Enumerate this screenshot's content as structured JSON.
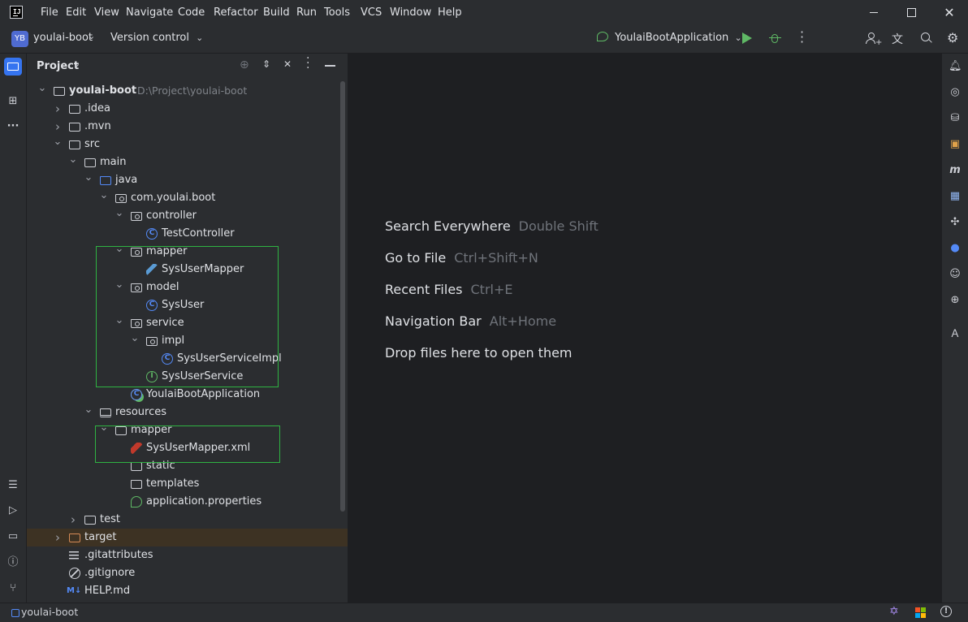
{
  "menu": [
    "File",
    "Edit",
    "View",
    "Navigate",
    "Code",
    "Refactor",
    "Build",
    "Run",
    "Tools",
    "VCS",
    "Window",
    "Help"
  ],
  "toolbar": {
    "project_badge": "YB",
    "project_name": "youlai-boot",
    "vcs_label": "Version control",
    "run_config": "YoulaiBootApplication"
  },
  "project_panel": {
    "title": "Project",
    "tree": [
      {
        "label": "youlai-boot",
        "path": "D:\\Project\\youlai-boot",
        "icon": "module-folder-icon"
      },
      {
        "label": ".idea",
        "icon": "folder-icon"
      },
      {
        "label": ".mvn",
        "icon": "folder-icon"
      },
      {
        "label": "src",
        "icon": "folder-icon"
      },
      {
        "label": "main",
        "icon": "folder-icon"
      },
      {
        "label": "java",
        "icon": "source-folder-icon"
      },
      {
        "label": "com.youlai.boot",
        "icon": "package-icon"
      },
      {
        "label": "controller",
        "icon": "package-icon"
      },
      {
        "label": "TestController",
        "icon": "class-icon"
      },
      {
        "label": "mapper",
        "icon": "package-icon"
      },
      {
        "label": "SysUserMapper",
        "icon": "mybatis-mapper-icon"
      },
      {
        "label": "model",
        "icon": "package-icon"
      },
      {
        "label": "SysUser",
        "icon": "class-icon"
      },
      {
        "label": "service",
        "icon": "package-icon"
      },
      {
        "label": "impl",
        "icon": "package-icon"
      },
      {
        "label": "SysUserServiceImpl",
        "icon": "class-icon"
      },
      {
        "label": "SysUserService",
        "icon": "interface-icon"
      },
      {
        "label": "YoulaiBootApplication",
        "icon": "spring-boot-class-icon"
      },
      {
        "label": "resources",
        "icon": "resources-folder-icon"
      },
      {
        "label": "mapper",
        "icon": "folder-icon"
      },
      {
        "label": "SysUserMapper.xml",
        "icon": "mybatis-xml-icon"
      },
      {
        "label": "static",
        "icon": "folder-icon"
      },
      {
        "label": "templates",
        "icon": "folder-icon"
      },
      {
        "label": "application.properties",
        "icon": "spring-properties-icon"
      },
      {
        "label": "test",
        "icon": "folder-icon"
      },
      {
        "label": "target",
        "icon": "excluded-folder-icon"
      },
      {
        "label": ".gitattributes",
        "icon": "text-file-icon"
      },
      {
        "label": ".gitignore",
        "icon": "gitignore-icon"
      },
      {
        "label": "HELP.md",
        "icon": "markdown-icon"
      }
    ]
  },
  "editor_hints": [
    {
      "action": "Search Everywhere",
      "shortcut": "Double Shift"
    },
    {
      "action": "Go to File",
      "shortcut": "Ctrl+Shift+N"
    },
    {
      "action": "Recent Files",
      "shortcut": "Ctrl+E"
    },
    {
      "action": "Navigation Bar",
      "shortcut": "Alt+Home"
    },
    {
      "action": "Drop files here to open them",
      "shortcut": ""
    }
  ],
  "status": {
    "project": "youlai-boot"
  },
  "colors": {
    "highlight_box": "#2fb342",
    "accent": "#548af7",
    "selected_row": "#3d3223"
  }
}
